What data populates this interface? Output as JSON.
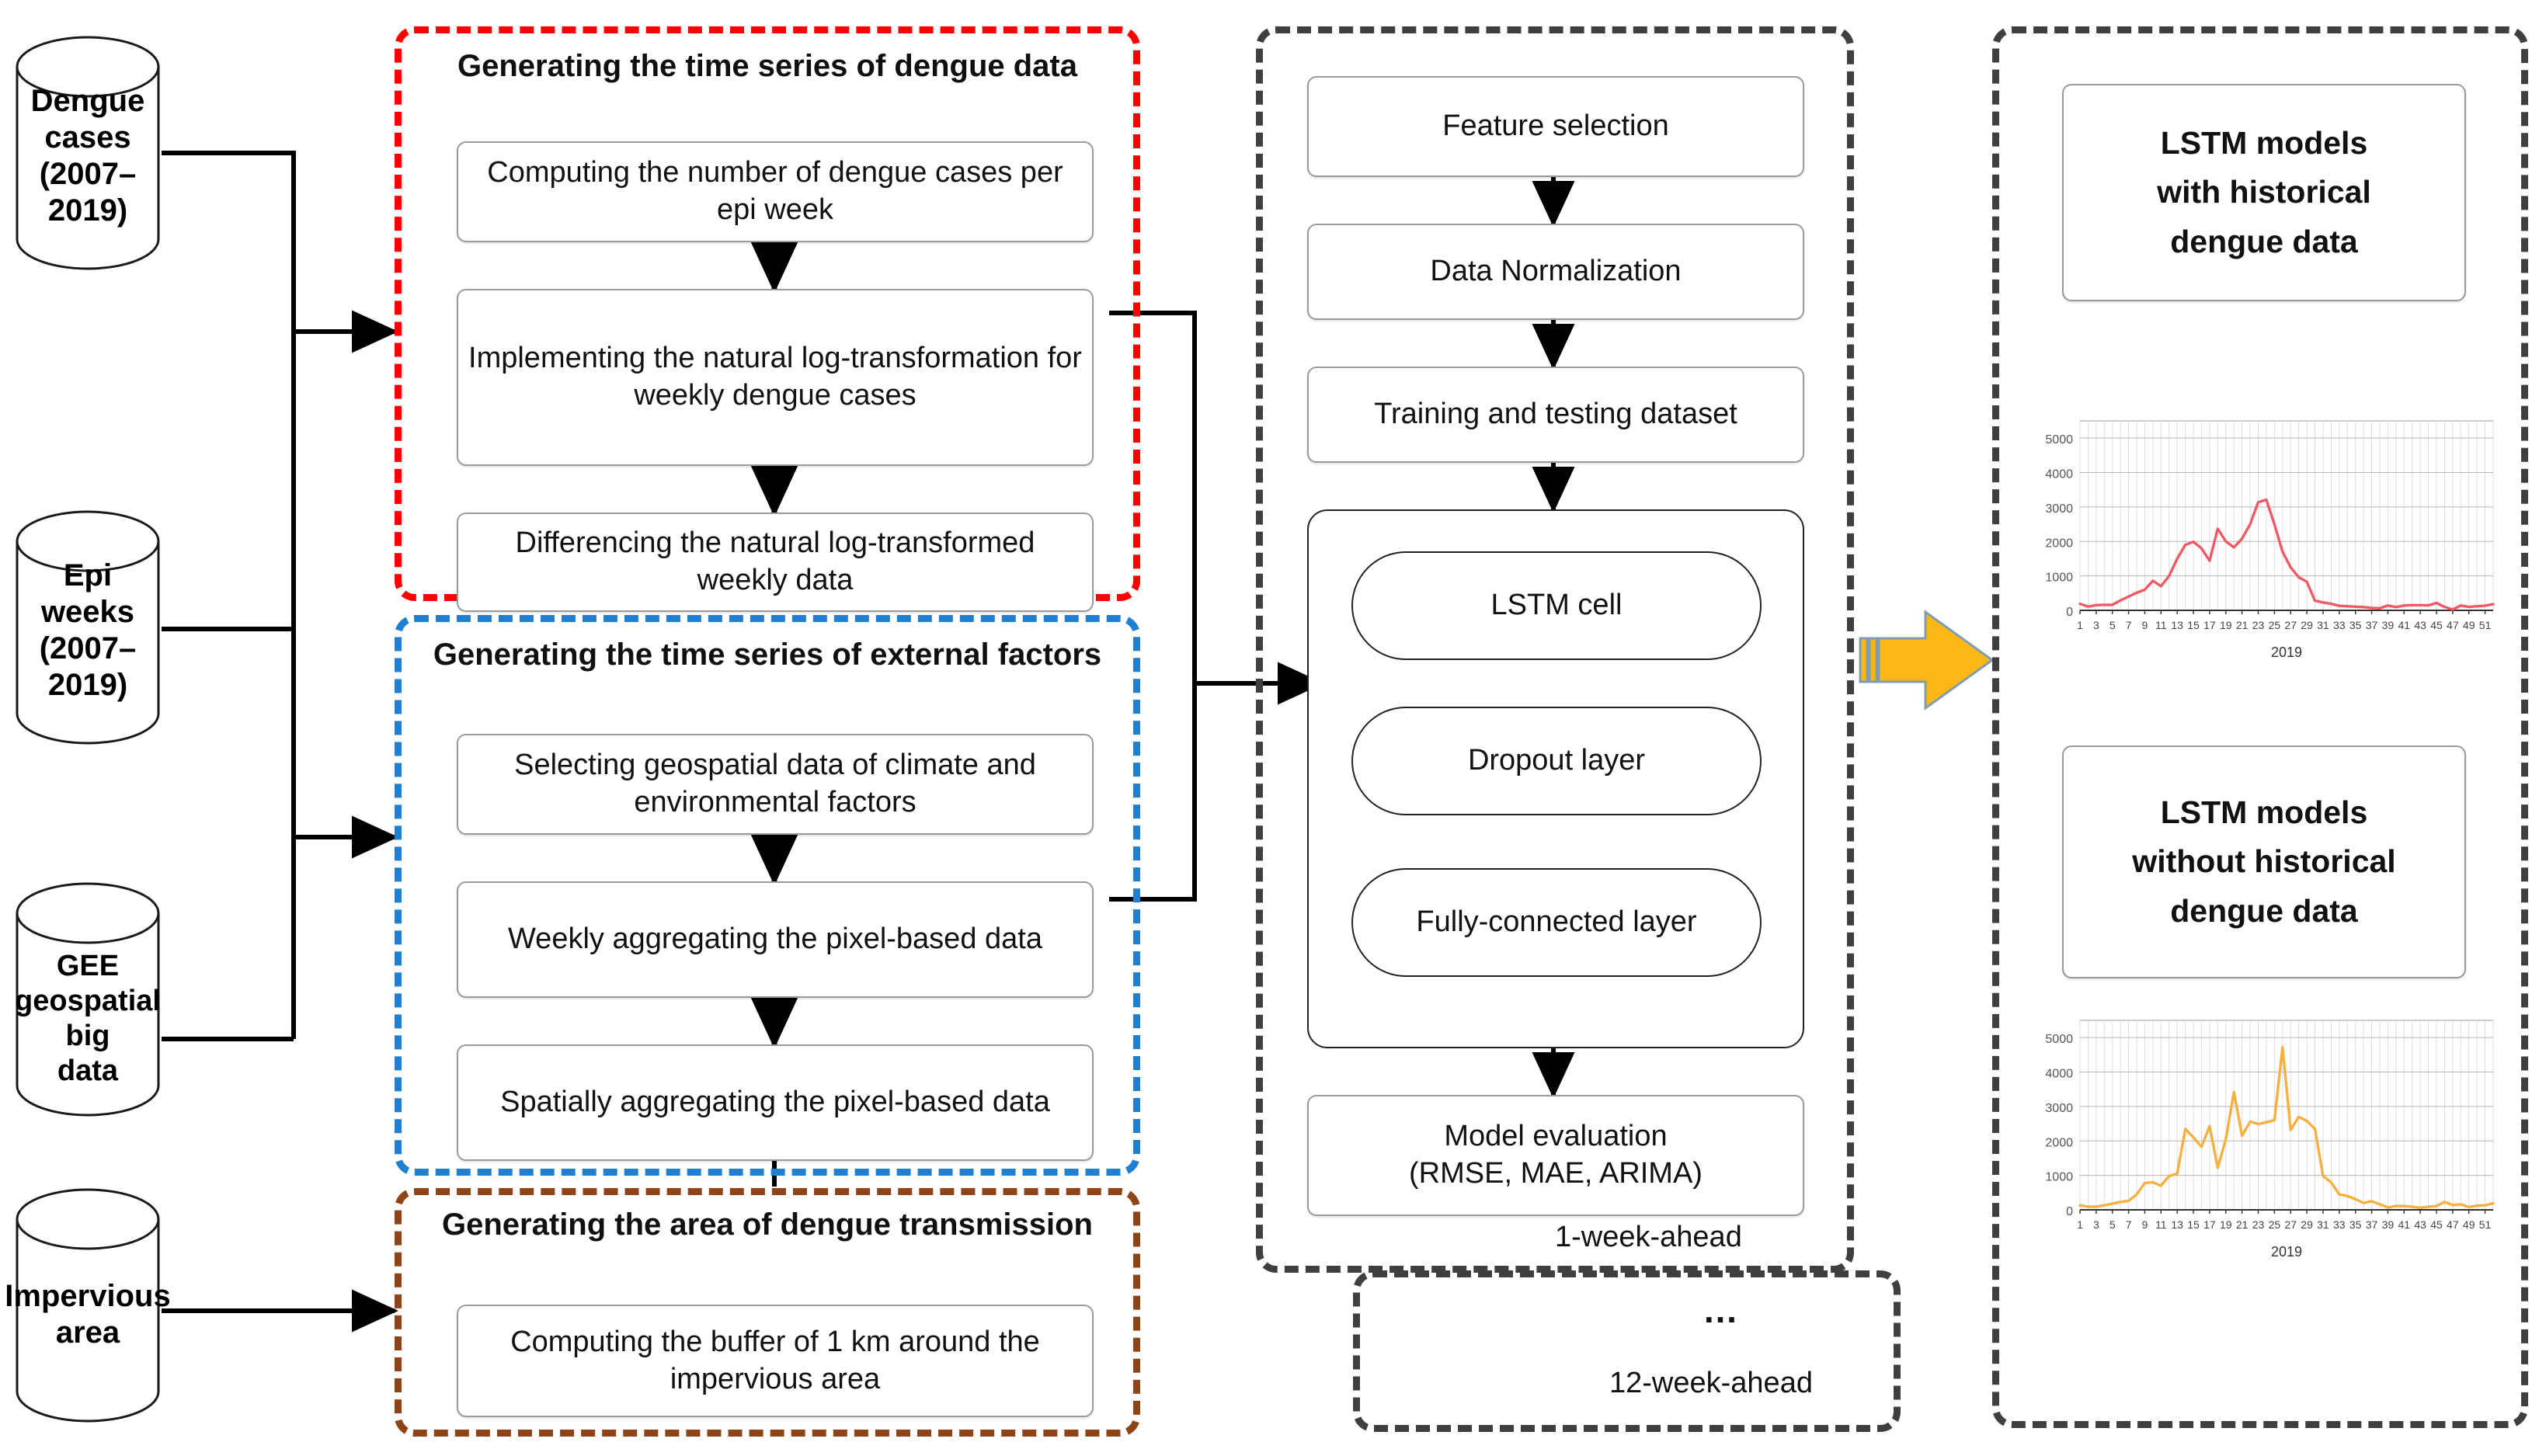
{
  "figure": {
    "kind": "workflow-diagram",
    "title_present": false
  },
  "sources": [
    {
      "id": "dengue-cases",
      "lines": [
        "Dengue cases",
        "(2007–2019)"
      ]
    },
    {
      "id": "epi-weeks",
      "lines": [
        "Epi weeks",
        "(2007–2019)"
      ]
    },
    {
      "id": "gee-big-data",
      "lines": [
        "GEE",
        "geospatial big",
        "data"
      ]
    },
    {
      "id": "impervious",
      "lines": [
        "Impervious",
        "area"
      ]
    }
  ],
  "groups": {
    "dengue_timeseries": {
      "title": "Generating the time series of dengue data",
      "border_color": "#FF0000",
      "steps": [
        "Computing the number of dengue cases per epi week",
        "Implementing the natural log-transformation for weekly dengue cases",
        "Differencing the natural log-transformed weekly data"
      ]
    },
    "external_factors": {
      "title": "Generating the time series of external factors",
      "border_color": "#1F7FD0",
      "steps": [
        "Selecting geospatial data of climate and environmental factors",
        "Weekly aggregating the pixel-based data",
        "Spatially aggregating the pixel-based data"
      ]
    },
    "transmission_area": {
      "title": "Generating the area of dengue transmission",
      "border_color": "#8E4416",
      "steps": [
        "Computing the buffer of 1 km around the impervious area"
      ]
    },
    "modeling": {
      "border_color": "#3F3F3F",
      "steps": [
        "Feature selection",
        "Data Normalization",
        "Training and testing dataset"
      ],
      "network_layers": [
        "LSTM cell",
        "Dropout layer",
        "Fully-connected layer"
      ],
      "evaluation": "Model evaluation (RMSE, MAE,  ARIMA)",
      "evaluation_line1": "Model evaluation",
      "evaluation_line2": "(RMSE, MAE,  ARIMA)",
      "horizon_first": "1-week-ahead",
      "horizon_ellipsis": "…",
      "horizon_last": "12-week-ahead"
    },
    "outputs": {
      "border_color": "#3F3F3F",
      "box_with_history_lines": [
        "LSTM models",
        "with historical",
        "dengue data"
      ],
      "box_without_history_lines": [
        "LSTM models",
        "without historical",
        "dengue data"
      ]
    }
  },
  "transfer_arrow": {
    "name": "process-transfer-arrow",
    "fill": "#FBB713",
    "stroke": "#7E9CB5"
  },
  "chart_data": [
    {
      "id": "chart-with-history",
      "type": "line",
      "title": "",
      "xlabel": "2019",
      "ylabel": "",
      "line_color": "#EE5B64",
      "grid": true,
      "ylim": [
        0,
        5500
      ],
      "yticks": [
        0,
        1000,
        2000,
        3000,
        4000,
        5000
      ],
      "ytick_labels": [
        "0",
        "1000",
        "2000",
        "3000",
        "4000",
        "5000"
      ],
      "xlim": [
        1,
        52
      ],
      "xticks": [
        1,
        3,
        5,
        7,
        9,
        11,
        13,
        15,
        17,
        19,
        21,
        23,
        25,
        27,
        29,
        31,
        33,
        35,
        37,
        39,
        41,
        43,
        45,
        47,
        49,
        51
      ],
      "x": [
        1,
        2,
        3,
        4,
        5,
        6,
        7,
        8,
        9,
        10,
        11,
        12,
        13,
        14,
        15,
        16,
        17,
        18,
        19,
        20,
        21,
        22,
        23,
        24,
        25,
        26,
        27,
        28,
        29,
        30,
        31,
        32,
        33,
        34,
        35,
        36,
        37,
        38,
        39,
        40,
        41,
        42,
        43,
        44,
        45,
        46,
        47,
        48,
        49,
        50,
        51,
        52
      ],
      "values": [
        190,
        110,
        150,
        160,
        160,
        290,
        400,
        510,
        600,
        860,
        700,
        1000,
        1500,
        1900,
        1990,
        1800,
        1440,
        2370,
        2000,
        1830,
        2080,
        2500,
        3140,
        3210,
        2500,
        1700,
        1250,
        960,
        830,
        280,
        230,
        190,
        130,
        120,
        105,
        95,
        70,
        60,
        140,
        95,
        140,
        150,
        150,
        145,
        215,
        100,
        25,
        140,
        100,
        120,
        135,
        180
      ]
    },
    {
      "id": "chart-without-history",
      "type": "line",
      "title": "",
      "xlabel": "2019",
      "ylabel": "",
      "line_color": "#F5B041",
      "grid": true,
      "ylim": [
        0,
        5500
      ],
      "yticks": [
        0,
        1000,
        2000,
        3000,
        4000,
        5000
      ],
      "ytick_labels": [
        "0",
        "1000",
        "2000",
        "3000",
        "4000",
        "5000"
      ],
      "xlim": [
        1,
        52
      ],
      "xticks": [
        1,
        3,
        5,
        7,
        9,
        11,
        13,
        15,
        17,
        19,
        21,
        23,
        25,
        27,
        29,
        31,
        33,
        35,
        37,
        39,
        41,
        43,
        45,
        47,
        49,
        51
      ],
      "x": [
        1,
        2,
        3,
        4,
        5,
        6,
        7,
        8,
        9,
        10,
        11,
        12,
        13,
        14,
        15,
        16,
        17,
        18,
        19,
        20,
        21,
        22,
        23,
        24,
        25,
        26,
        27,
        28,
        29,
        30,
        31,
        32,
        33,
        34,
        35,
        36,
        37,
        38,
        39,
        40,
        41,
        42,
        43,
        44,
        45,
        46,
        47,
        48,
        49,
        50,
        51,
        52
      ],
      "values": [
        130,
        90,
        90,
        130,
        180,
        230,
        260,
        450,
        780,
        800,
        700,
        980,
        1050,
        2350,
        2100,
        1830,
        2430,
        1220,
        2050,
        3420,
        2150,
        2560,
        2490,
        2540,
        2600,
        4720,
        2320,
        2700,
        2580,
        2350,
        980,
        800,
        450,
        400,
        310,
        200,
        250,
        160,
        70,
        110,
        110,
        90,
        60,
        90,
        110,
        230,
        140,
        160,
        80,
        120,
        130,
        190
      ]
    }
  ]
}
